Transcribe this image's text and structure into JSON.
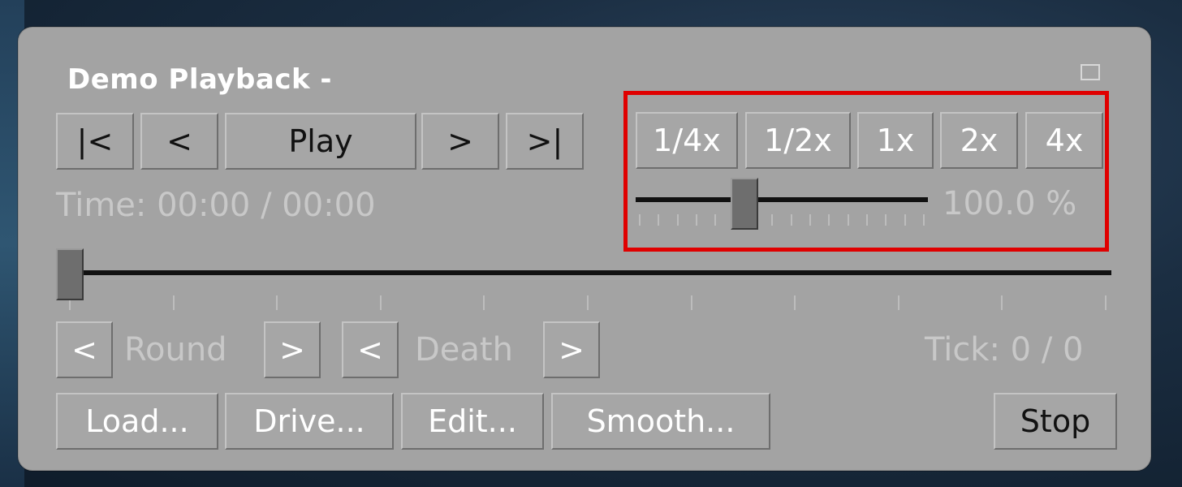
{
  "window": {
    "title": "Demo Playback -"
  },
  "transport": {
    "first_label": "|<",
    "prev_label": "<",
    "play_label": "Play",
    "next_label": ">",
    "last_label": ">|"
  },
  "time": {
    "text": "Time: 00:00 / 00:00"
  },
  "speed": {
    "buttons": [
      "1/4x",
      "1/2x",
      "1x",
      "2x",
      "4x"
    ],
    "value_text": "100.0 %",
    "slider_fraction": 0.36
  },
  "timeline": {
    "position_fraction": 0.0
  },
  "nav": {
    "prev_round_label": "<",
    "round_label": "Round",
    "next_round_label": ">",
    "prev_death_label": "<",
    "death_label": "Death",
    "next_death_label": ">",
    "tick_text": "Tick: 0 / 0"
  },
  "actions": {
    "load_label": "Load...",
    "drive_label": "Drive...",
    "edit_label": "Edit...",
    "smooth_label": "Smooth...",
    "stop_label": "Stop"
  },
  "colors": {
    "panel": "#a3a3a3",
    "highlight": "#e00000"
  }
}
